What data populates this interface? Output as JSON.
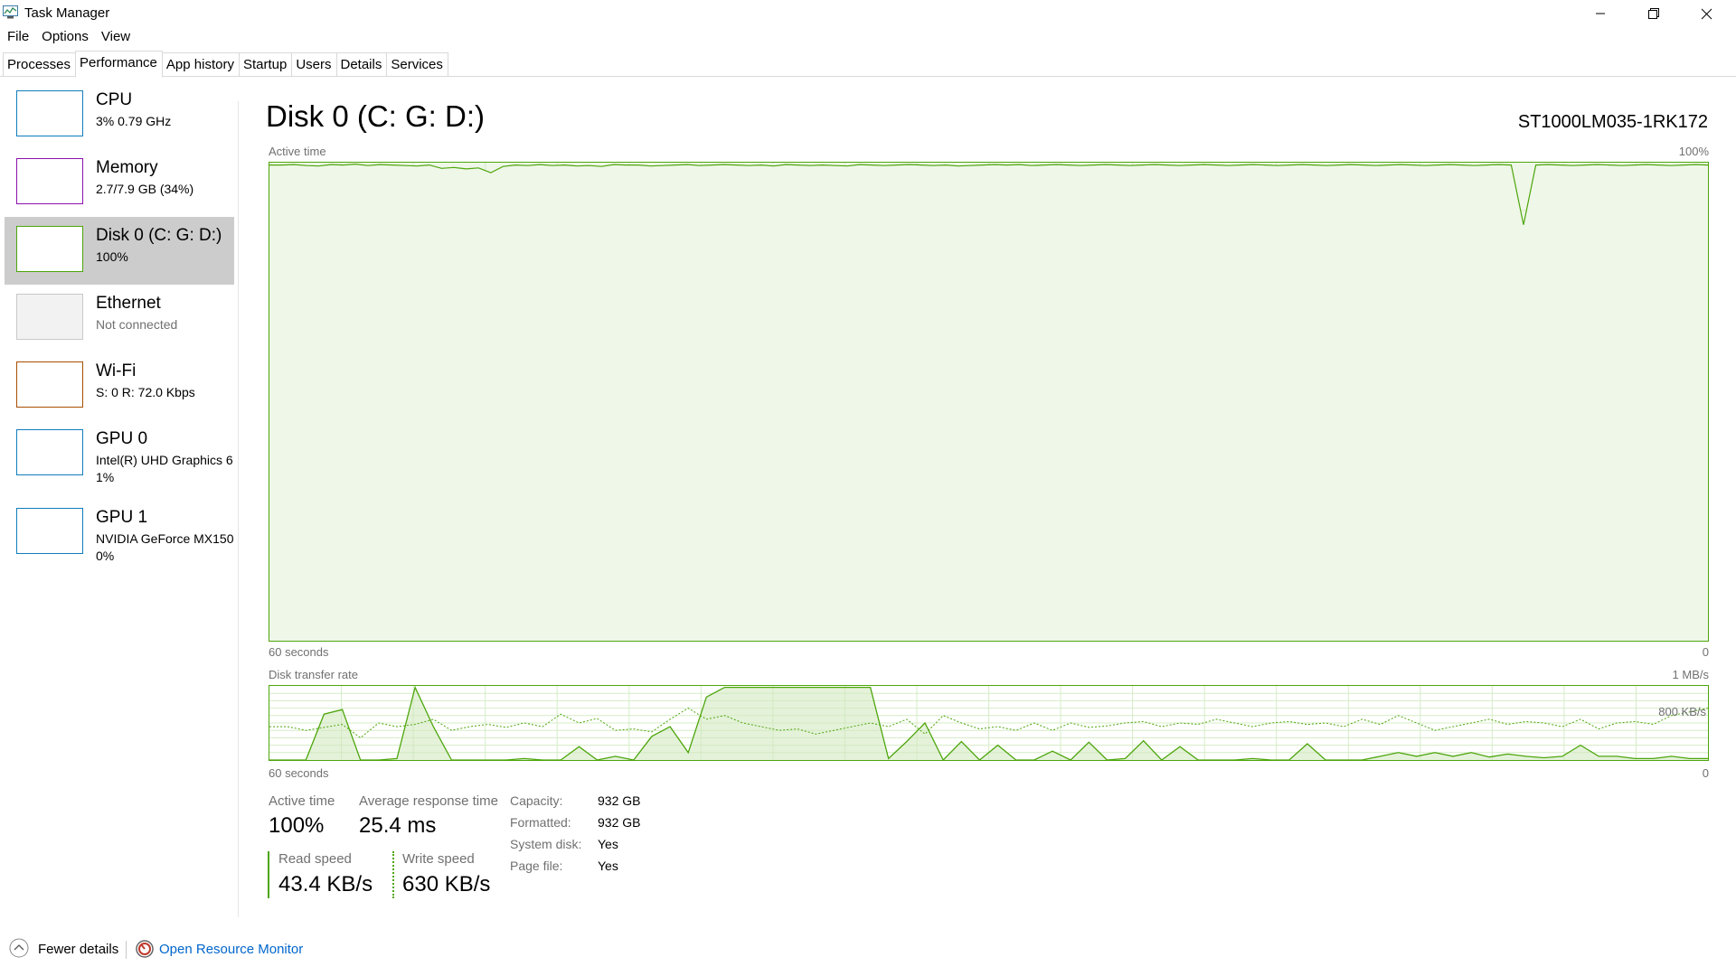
{
  "window": {
    "title": "Task Manager",
    "app_icon": "task-manager-icon",
    "controls": [
      "minimize-icon",
      "restore-icon",
      "close-icon"
    ]
  },
  "menu": [
    "File",
    "Options",
    "View"
  ],
  "tabs": [
    {
      "label": "Processes",
      "active": false
    },
    {
      "label": "Performance",
      "active": true
    },
    {
      "label": "App history",
      "active": false
    },
    {
      "label": "Startup",
      "active": false
    },
    {
      "label": "Users",
      "active": false
    },
    {
      "label": "Details",
      "active": false
    },
    {
      "label": "Services",
      "active": false
    }
  ],
  "sidebar": {
    "items": [
      {
        "name": "CPU",
        "sub": "3%  0.79 GHz",
        "sub2": "",
        "color": "#117dbb",
        "selected": false
      },
      {
        "name": "Memory",
        "sub": "2.7/7.9 GB (34%)",
        "sub2": "",
        "color": "#8b12ae",
        "selected": false
      },
      {
        "name": "Disk 0 (C: G: D:)",
        "sub": "100%",
        "sub2": "",
        "color": "#4da60c",
        "selected": true
      },
      {
        "name": "Ethernet",
        "sub": "Not connected",
        "sub2": "",
        "color": "#c8c8c8",
        "selected": false
      },
      {
        "name": "Wi-Fi",
        "sub": "S: 0  R: 72.0 Kbps",
        "sub2": "",
        "color": "#a74f01",
        "selected": false
      },
      {
        "name": "GPU 0",
        "sub": "Intel(R) UHD Graphics 6",
        "sub2": "1%",
        "color": "#117dbb",
        "selected": false
      },
      {
        "name": "GPU 1",
        "sub": "NVIDIA GeForce MX150",
        "sub2": "0%",
        "color": "#117dbb",
        "selected": false
      }
    ]
  },
  "main": {
    "title": "Disk 0 (C: G: D:)",
    "model": "ST1000LM035-1RK172",
    "active_graph": {
      "label": "Active time",
      "max_label": "100%",
      "time_label": "60 seconds",
      "min_label": "0",
      "values": [
        99.5,
        99.5,
        99.6,
        99.4,
        99.3,
        99.6,
        99.5,
        99.7,
        99.4,
        99.6,
        99.5,
        99.4,
        99.3,
        99.5,
        98.8,
        99.0,
        98.7,
        98.9,
        97.9,
        99.2,
        99.5,
        99.4,
        99.6,
        99.4,
        99.5,
        99.3,
        99.4,
        99.2,
        99.6,
        99.5,
        99.5,
        99.3,
        99.4,
        99.5,
        99.6,
        99.4,
        99.5,
        99.6,
        99.5,
        99.4,
        99.5,
        99.3,
        99.6,
        99.5,
        99.4,
        99.5,
        99.4,
        99.3,
        99.6,
        99.5,
        99.4,
        99.5,
        99.6,
        99.5,
        99.4,
        99.5,
        99.3,
        99.4,
        99.5,
        99.6,
        99.5,
        99.6,
        99.4,
        99.5,
        99.6,
        99.5,
        99.4,
        99.5,
        99.6,
        99.5,
        99.4,
        99.5,
        99.6,
        99.5,
        99.4,
        99.5,
        99.6,
        99.5,
        99.4,
        99.5,
        99.6,
        99.5,
        99.4,
        99.5,
        99.6,
        99.5,
        99.4,
        99.5,
        99.6,
        99.5,
        99.4,
        99.5,
        99.6,
        99.5,
        99.4,
        99.5,
        99.6,
        99.5,
        99.4,
        99.5,
        99.6,
        99.5,
        87.0,
        99.5,
        99.6,
        99.5,
        99.4,
        99.5,
        99.6,
        99.5,
        99.4,
        99.5,
        99.6,
        99.5,
        99.4,
        99.5,
        99.6,
        99.5
      ]
    },
    "transfer_graph": {
      "label": "Disk transfer rate",
      "max_label": "1 MB/s",
      "ref_label": "800 KB/s",
      "time_label": "60 seconds",
      "min_label": "0",
      "read": [
        0,
        0,
        0,
        0.62,
        0.68,
        0,
        0,
        0.02,
        0.98,
        0.45,
        0,
        0,
        0,
        0,
        0.02,
        0,
        0,
        0.18,
        0,
        0.05,
        0,
        0.32,
        0.45,
        0.1,
        0.85,
        0.98,
        0.98,
        0.98,
        0.98,
        0.98,
        0.98,
        0.98,
        0.98,
        0.98,
        0.02,
        0.25,
        0.5,
        0,
        0.25,
        0,
        0.2,
        0,
        0,
        0.12,
        0,
        0.24,
        0,
        0.02,
        0.26,
        0,
        0.18,
        0,
        0,
        0,
        0.02,
        0,
        0,
        0.22,
        0,
        0,
        0,
        0.05,
        0.1,
        0.05,
        0.1,
        0.05,
        0.1,
        0.04,
        0.08,
        0.05,
        0.03,
        0.05,
        0.2,
        0.05,
        0.05,
        0.02,
        0.02,
        0.05,
        0.02,
        0.02
      ],
      "write": [
        0.45,
        0.45,
        0.4,
        0.44,
        0.48,
        0.3,
        0.5,
        0.45,
        0.48,
        0.55,
        0.4,
        0.45,
        0.48,
        0.44,
        0.5,
        0.45,
        0.62,
        0.5,
        0.56,
        0.4,
        0.42,
        0.38,
        0.55,
        0.7,
        0.55,
        0.6,
        0.5,
        0.45,
        0.4,
        0.42,
        0.35,
        0.4,
        0.45,
        0.5,
        0.45,
        0.55,
        0.35,
        0.6,
        0.5,
        0.42,
        0.45,
        0.4,
        0.5,
        0.4,
        0.5,
        0.44,
        0.46,
        0.5,
        0.52,
        0.45,
        0.5,
        0.48,
        0.55,
        0.5,
        0.45,
        0.5,
        0.52,
        0.48,
        0.5,
        0.45,
        0.55,
        0.48,
        0.6,
        0.5,
        0.4,
        0.45,
        0.5,
        0.55,
        0.48,
        0.52,
        0.5,
        0.45,
        0.55,
        0.42,
        0.5,
        0.52,
        0.48,
        0.6,
        0.65,
        0.7
      ]
    },
    "stats": {
      "active_time_label": "Active time",
      "active_time_value": "100%",
      "avg_response_label": "Average response time",
      "avg_response_value": "25.4 ms",
      "read_label": "Read speed",
      "read_value": "43.4 KB/s",
      "write_label": "Write speed",
      "write_value": "630 KB/s"
    },
    "details": [
      {
        "label": "Capacity:",
        "value": "932 GB"
      },
      {
        "label": "Formatted:",
        "value": "932 GB"
      },
      {
        "label": "System disk:",
        "value": "Yes"
      },
      {
        "label": "Page file:",
        "value": "Yes"
      }
    ]
  },
  "footer": {
    "fewer_details": "Fewer details",
    "fewer_icon": "chevron-up-icon",
    "resource_monitor": "Open Resource Monitor",
    "resource_icon": "resource-monitor-icon"
  },
  "colors": {
    "disk": "#4da60c",
    "disk_fill": "#eff7e8",
    "grid": "#d6ecc6",
    "link": "#0066cc"
  }
}
